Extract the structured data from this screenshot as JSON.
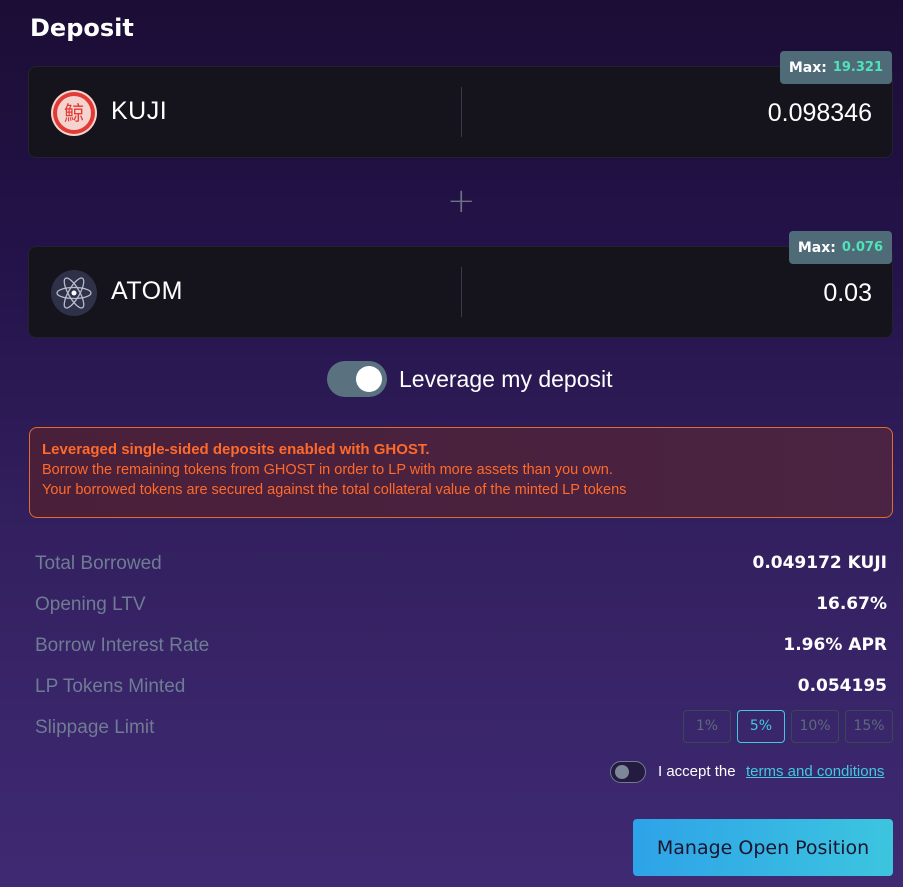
{
  "page": {
    "title": "Deposit"
  },
  "assets": [
    {
      "symbol": "KUJI",
      "amount": "0.098346",
      "max_label": "Max:",
      "max_value": "19.321"
    },
    {
      "symbol": "ATOM",
      "amount": "0.03",
      "max_label": "Max:",
      "max_value": "0.076"
    }
  ],
  "leverage": {
    "label": "Leverage my deposit",
    "enabled": true
  },
  "notice": {
    "heading": "Leveraged single-sided deposits enabled with GHOST.",
    "line1": "Borrow the remaining tokens from GHOST in order to LP with more assets than you own.",
    "line2": "Your borrowed tokens are secured against the total collateral value of the minted LP tokens"
  },
  "stats": [
    {
      "label": "Total Borrowed",
      "value": "0.049172 KUJI"
    },
    {
      "label": "Opening LTV",
      "value": "16.67%"
    },
    {
      "label": "Borrow Interest Rate",
      "value": "1.96% APR"
    },
    {
      "label": "LP Tokens Minted",
      "value": "0.054195"
    }
  ],
  "slippage": {
    "label": "Slippage Limit",
    "options": [
      "1%",
      "5%",
      "10%",
      "15%"
    ],
    "selected": "5%"
  },
  "terms": {
    "prefix": "I accept the",
    "link": "terms and conditions"
  },
  "cta": {
    "label": "Manage Open Position"
  },
  "colors": {
    "accent": "#41c9dc",
    "warning": "#ff6a2b",
    "max_value": "#4fe3b8",
    "kuji_red": "#e23a34"
  }
}
